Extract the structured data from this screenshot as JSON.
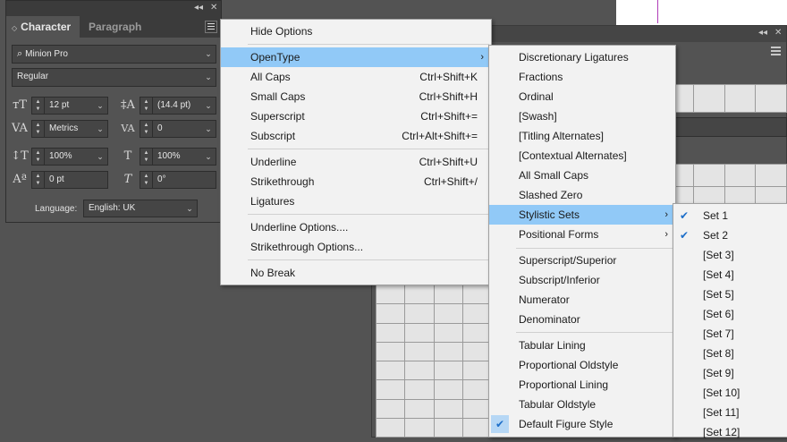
{
  "character_panel": {
    "tab_active": "Character",
    "tab_inactive": "Paragraph",
    "font_family": "Minion Pro",
    "font_style": "Regular",
    "font_size": "12 pt",
    "leading": "(14.4 pt)",
    "kerning": "Metrics",
    "tracking": "0",
    "vertical_scale": "100%",
    "horizontal_scale": "100%",
    "baseline_shift": "0 pt",
    "skew": "0°",
    "language_label": "Language:",
    "language_value": "English: UK"
  },
  "main_menu": {
    "items": [
      {
        "label": "Hide Options",
        "shortcut": ""
      },
      {
        "label": "OpenType",
        "shortcut": ""
      },
      {
        "label": "All Caps",
        "shortcut": "Ctrl+Shift+K"
      },
      {
        "label": "Small Caps",
        "shortcut": "Ctrl+Shift+H"
      },
      {
        "label": "Superscript",
        "shortcut": "Ctrl+Shift+="
      },
      {
        "label": "Subscript",
        "shortcut": "Ctrl+Alt+Shift+="
      },
      {
        "label": "Underline",
        "shortcut": "Ctrl+Shift+U"
      },
      {
        "label": "Strikethrough",
        "shortcut": "Ctrl+Shift+/"
      },
      {
        "label": "Ligatures",
        "shortcut": ""
      },
      {
        "label": "Underline Options....",
        "shortcut": ""
      },
      {
        "label": "Strikethrough Options...",
        "shortcut": ""
      },
      {
        "label": "No Break",
        "shortcut": ""
      }
    ]
  },
  "opentype_menu": {
    "items": [
      "Discretionary Ligatures",
      "Fractions",
      "Ordinal",
      "[Swash]",
      "[Titling Alternates]",
      "[Contextual Alternates]",
      "All Small Caps",
      "Slashed Zero",
      "Stylistic Sets",
      "Positional Forms",
      "Superscript/Superior",
      "Subscript/Inferior",
      "Numerator",
      "Denominator",
      "Tabular Lining",
      "Proportional Oldstyle",
      "Proportional Lining",
      "Tabular Oldstyle",
      "Default Figure Style"
    ]
  },
  "stylistic_sets_menu": {
    "items": [
      "Set 1",
      "Set 2",
      "[Set 3]",
      "[Set 4]",
      "[Set 5]",
      "[Set 6]",
      "[Set 7]",
      "[Set 8]",
      "[Set 9]",
      "[Set 10]",
      "[Set 11]",
      "[Set 12]"
    ],
    "checked": [
      "Set 1",
      "Set 2"
    ]
  },
  "colors": {
    "highlight": "#91c9f7",
    "menu_bg": "#f2f2f2",
    "panel_bg": "#535353",
    "check": "#1e6fc9"
  }
}
